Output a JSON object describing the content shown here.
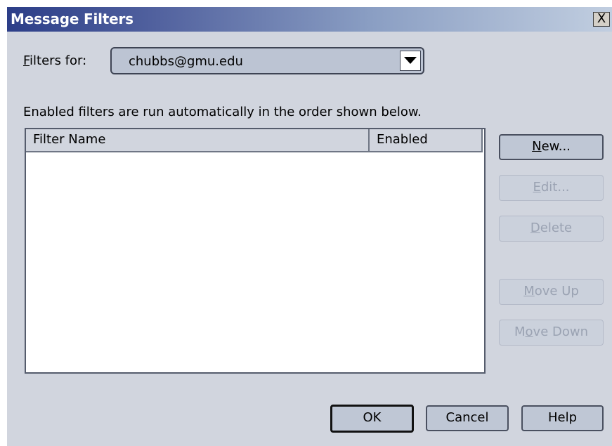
{
  "window": {
    "title": "Message Filters",
    "close_label": "X"
  },
  "filters_for": {
    "label_prefix_underlined": "F",
    "label_rest": "ilters for:",
    "selected_account": "chubbs@gmu.edu"
  },
  "description": "Enabled filters are run automatically in the order shown below.",
  "filter_list": {
    "columns": [
      "Filter Name",
      "Enabled"
    ],
    "rows": []
  },
  "side_buttons": {
    "new": {
      "mnemonic": "N",
      "rest": "ew...",
      "enabled": true
    },
    "edit": {
      "mnemonic": "E",
      "rest": "dit...",
      "enabled": false
    },
    "delete": {
      "mnemonic": "D",
      "rest": "elete",
      "enabled": false
    },
    "move_up": {
      "mnemonic": "M",
      "rest": "ove Up",
      "enabled": false
    },
    "move_down": {
      "pre": "M",
      "mnemonic": "o",
      "rest": "ve Down",
      "enabled": false
    }
  },
  "footer_buttons": {
    "ok": "OK",
    "cancel": "Cancel",
    "help": "Help"
  },
  "colors": {
    "dialog_background": "#d1d5de",
    "title_gradient_start": "#2c3e88",
    "title_gradient_end": "#c1cee0",
    "disabled_text": "#9aa2b2"
  },
  "icons": {
    "dropdown": "chevron-down-icon",
    "close": "close-icon"
  }
}
